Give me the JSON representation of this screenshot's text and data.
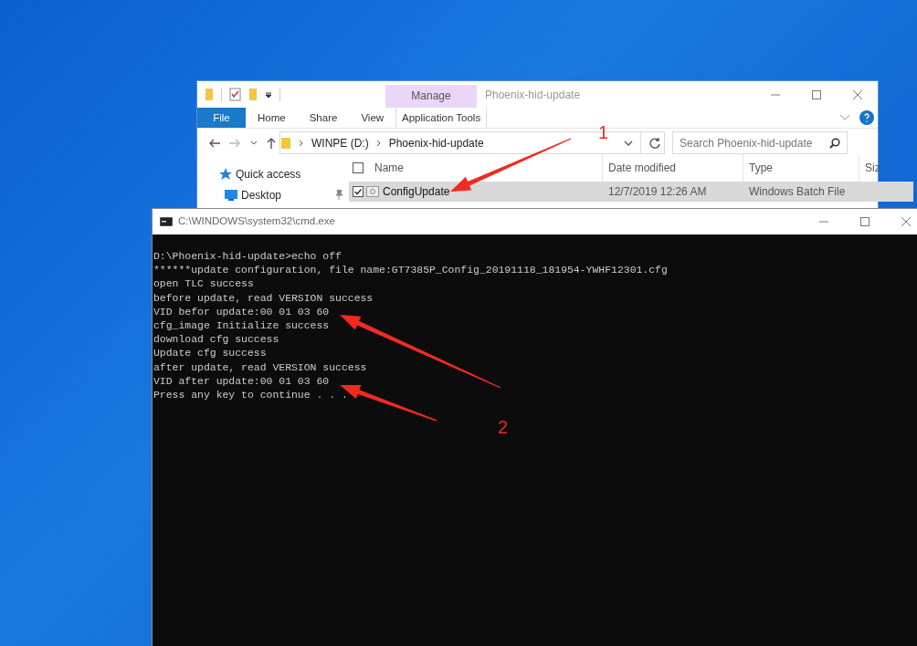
{
  "explorer": {
    "title": "Phoenix-hid-update",
    "context_tab": {
      "group": "Manage",
      "label": "Application Tools"
    },
    "ribbon_tabs": [
      {
        "label": "File",
        "kind": "file"
      },
      {
        "label": "Home",
        "kind": "tab"
      },
      {
        "label": "Share",
        "kind": "tab"
      },
      {
        "label": "View",
        "kind": "tab"
      }
    ],
    "address": [
      "WINPE (D:)",
      "Phoenix-hid-update"
    ],
    "search": {
      "placeholder": "Search Phoenix-hid-update"
    },
    "nav": [
      {
        "label": "Quick access",
        "kind": "star"
      },
      {
        "label": "Desktop",
        "kind": "desktop"
      }
    ],
    "columns": [
      "Name",
      "Date modified",
      "Type",
      "Siz"
    ],
    "select_all_checked": false,
    "rows": [
      {
        "cells": [
          "ConfigUpdate",
          "12/7/2019 12:26 AM",
          "Windows Batch File"
        ],
        "selected": true,
        "checked": true
      }
    ]
  },
  "cmd": {
    "title": "C:\\WINDOWS\\system32\\cmd.exe",
    "lines": [
      "D:\\Phoenix-hid-update>echo off",
      "******update configuration, file name:GT7385P_Config_20191118_181954-YWHF12301.cfg",
      "open TLC success",
      "before update, read VERSION success",
      "VID befor update:00 01 03 60",
      "cfg_image Initialize success",
      "download cfg success",
      "Update cfg success",
      "after update, read VERSION success",
      "VID after update:00 01 03 60",
      "Press any key to continue . . ."
    ]
  },
  "annotations": [
    "1",
    "2"
  ]
}
